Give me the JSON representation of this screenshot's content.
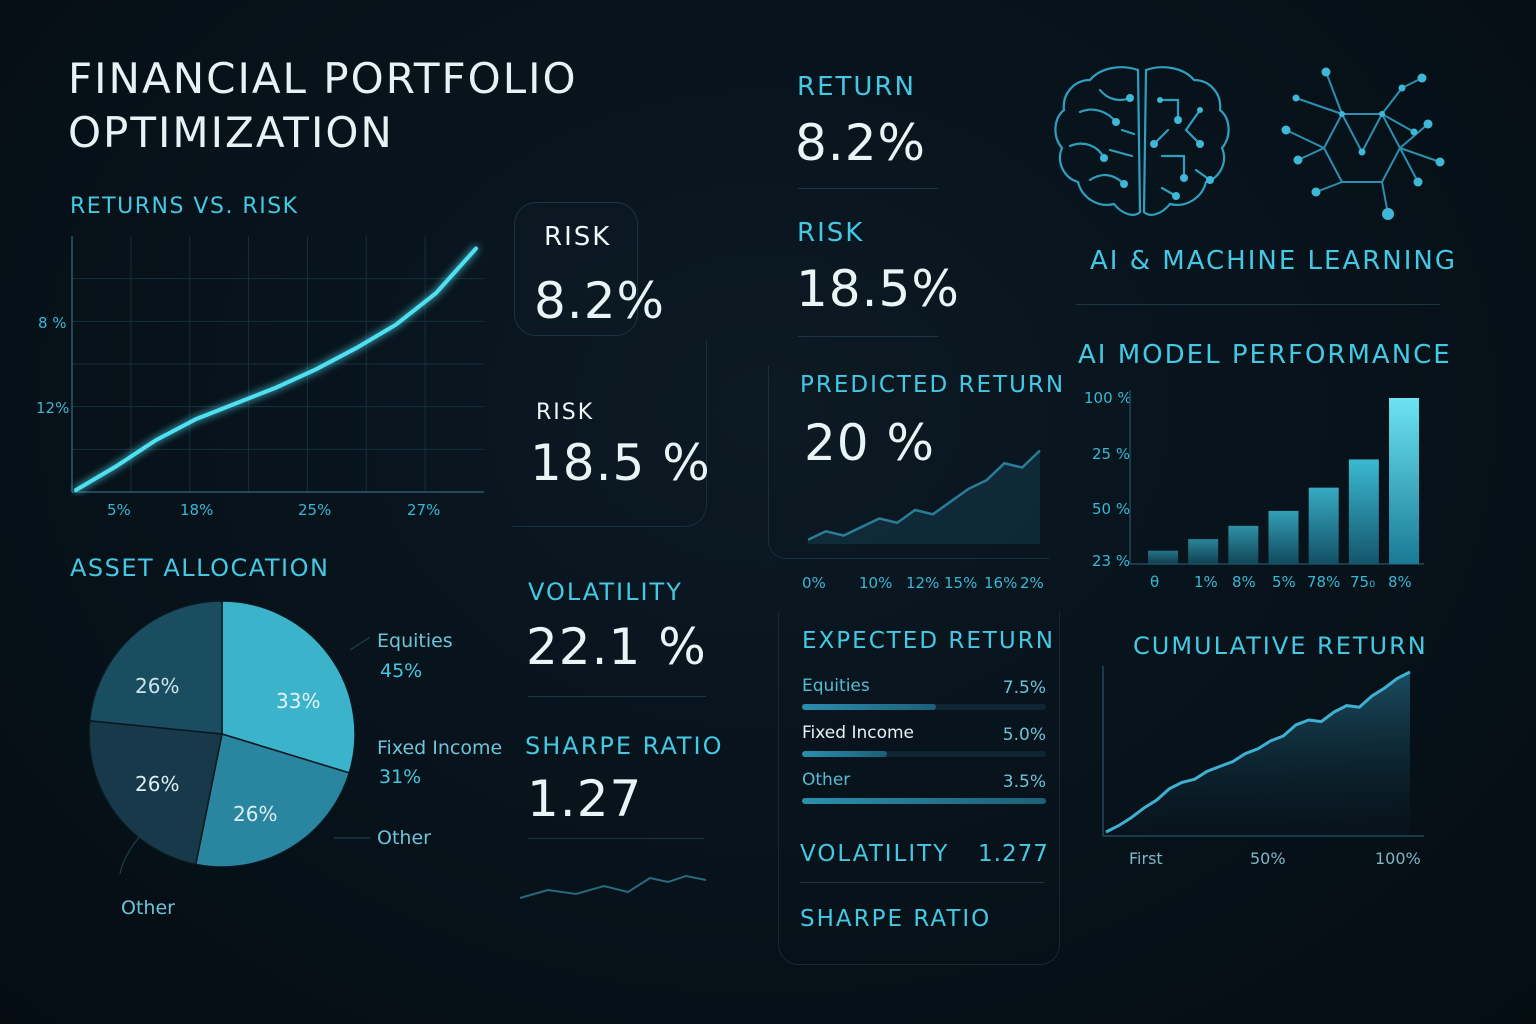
{
  "title": {
    "line1": "FINANCIAL PORTFOLIO",
    "line2": "OPTIMIZATION"
  },
  "colors": {
    "accent": "#45c8e3",
    "background": "#07121a",
    "text": "#e6f2f4"
  },
  "returns_risk": {
    "title": "RETURNS VS. RISK",
    "y_ticks": [
      "8 %",
      "12%"
    ],
    "x_ticks": [
      "5%",
      "18%",
      "25%",
      "27%"
    ]
  },
  "risk_card": {
    "label": "RISK",
    "value": "8.2%"
  },
  "risk2": {
    "label": "RISK",
    "value": "18.5 %"
  },
  "volatility": {
    "label": "VOLATILITY",
    "value": "22.1 %"
  },
  "sharpe": {
    "label": "SHARPE RATIO",
    "value": "1.27"
  },
  "return_block": {
    "label": "RETURN",
    "value": "8.2%"
  },
  "risk3": {
    "label": "RISK",
    "value": "18.5%"
  },
  "predicted": {
    "label": "PREDICTED RETURN",
    "value": "20 %",
    "x_ticks": [
      "0%",
      "10%",
      "12%",
      "15%",
      "16%",
      "2%"
    ]
  },
  "expected": {
    "title": "EXPECTED RETURN",
    "rows": [
      {
        "name": "Equities",
        "value": "7.5%",
        "fill": 0.55
      },
      {
        "name": "Fixed Income",
        "value": "5.0%",
        "fill": 0.35
      },
      {
        "name": "Other",
        "value": "3.5%",
        "fill": 1.0
      }
    ]
  },
  "vol_bottom": {
    "label": "VOLATILITY",
    "value": "1.277"
  },
  "sharpe_bottom": {
    "label": "SHARPE RATIO"
  },
  "ai": {
    "title": "AI & MACHINE LEARNING",
    "brain_icon": "brain-icon",
    "network_icon": "network-icon"
  },
  "allocation": {
    "title": "ASSET ALLOCATION",
    "slice_labels": [
      "33%",
      "26%",
      "26%",
      "26%"
    ],
    "legend": [
      {
        "name": "Equities",
        "value": "45%"
      },
      {
        "name": "Fixed Income",
        "value": "31%"
      },
      {
        "name": "Other",
        "value": ""
      }
    ],
    "outside_label": "Other"
  },
  "ai_perf": {
    "title": "AI MODEL PERFORMANCE",
    "y_ticks": [
      "100 %",
      "25 %",
      "50 %",
      "23 %"
    ],
    "x_ticks": [
      "θ",
      "1%",
      "8%",
      "5%",
      "78%",
      "75₀",
      "8%"
    ]
  },
  "cumulative": {
    "title": "CUMULATIVE RETURN",
    "x_ticks": [
      "First",
      "50%",
      "100%"
    ]
  },
  "chart_data": [
    {
      "type": "line",
      "title": "RETURNS VS. RISK",
      "x_ticks": [
        "5%",
        "18%",
        "25%",
        "27%"
      ],
      "y_ticks": [
        "8 %",
        "12%"
      ],
      "x": [
        0,
        1,
        2,
        3,
        4,
        5,
        6,
        7,
        8,
        9,
        10
      ],
      "values": [
        0.0,
        0.9,
        1.9,
        2.7,
        3.3,
        3.9,
        4.6,
        5.4,
        6.3,
        7.5,
        9.2
      ],
      "grid": true
    },
    {
      "type": "pie",
      "title": "ASSET ALLOCATION",
      "labels": [
        "33%",
        "26%",
        "26%",
        "26%"
      ],
      "values": [
        33,
        26,
        26,
        26
      ]
    },
    {
      "type": "line",
      "title": "PREDICTED RETURN",
      "x_ticks": [
        "0%",
        "10%",
        "12%",
        "15%",
        "16%",
        "2%"
      ],
      "values": [
        1,
        3,
        2,
        4,
        6,
        5,
        8,
        7,
        10,
        13,
        15,
        19,
        18,
        22
      ]
    },
    {
      "type": "bar",
      "title": "AI MODEL PERFORMANCE",
      "categories": [
        "θ",
        "1%",
        "8%",
        "5%",
        "78%",
        "75₀",
        "8%"
      ],
      "values": [
        8,
        15,
        23,
        32,
        46,
        63,
        100
      ],
      "y_ticks": [
        "100 %",
        "25 %",
        "50 %",
        "23 %"
      ]
    },
    {
      "type": "area",
      "title": "CUMULATIVE RETURN",
      "x_ticks": [
        "First",
        "50%",
        "100%"
      ],
      "values": [
        0,
        4,
        9,
        15,
        20,
        27,
        31,
        33,
        38,
        41,
        44,
        49,
        52,
        57,
        60,
        67,
        70,
        69,
        75,
        79,
        78,
        85,
        90,
        96,
        100
      ]
    }
  ]
}
